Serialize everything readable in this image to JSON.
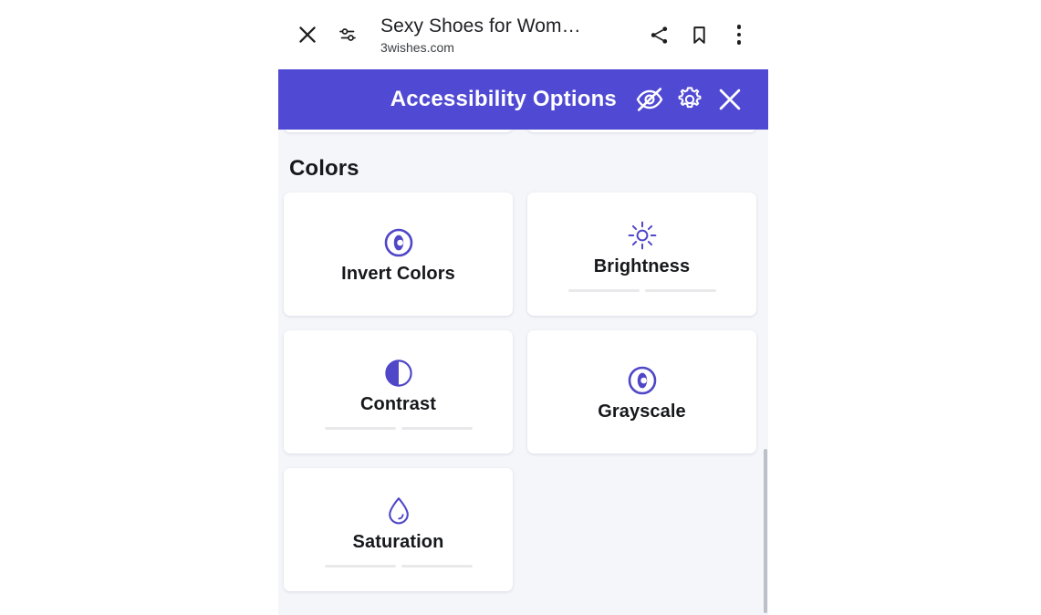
{
  "browser": {
    "close_label": "close-tab",
    "page_info_label": "page-info",
    "title": "Sexy Shoes for Wom…",
    "origin": "3wishes.com",
    "share_label": "share",
    "bookmark_label": "bookmark",
    "menu_label": "more-options"
  },
  "a11y_header": {
    "title": "Accessibility Options",
    "hide_label": "hide-accessibility",
    "settings_label": "accessibility-settings",
    "close_label": "close-accessibility",
    "background_color": "#5049d4",
    "text_color": "#ffffff"
  },
  "panel": {
    "background_color": "#f4f6fa",
    "card_background_color": "#ffffff",
    "icon_color": "#5049d4",
    "label_color": "#17181c",
    "sections": [
      {
        "title": "Colors",
        "cards": [
          {
            "label": "Invert Colors",
            "icon": "invert-colors-icon",
            "has_slider": false
          },
          {
            "label": "Brightness",
            "icon": "brightness-sun-icon",
            "has_slider": true
          },
          {
            "label": "Contrast",
            "icon": "contrast-half-circle-icon",
            "has_slider": true
          },
          {
            "label": "Grayscale",
            "icon": "grayscale-icon",
            "has_slider": false
          },
          {
            "label": "Saturation",
            "icon": "saturation-droplet-icon",
            "has_slider": true
          }
        ]
      }
    ]
  },
  "scrollbar": {
    "label": "vertical-scrollbar"
  }
}
